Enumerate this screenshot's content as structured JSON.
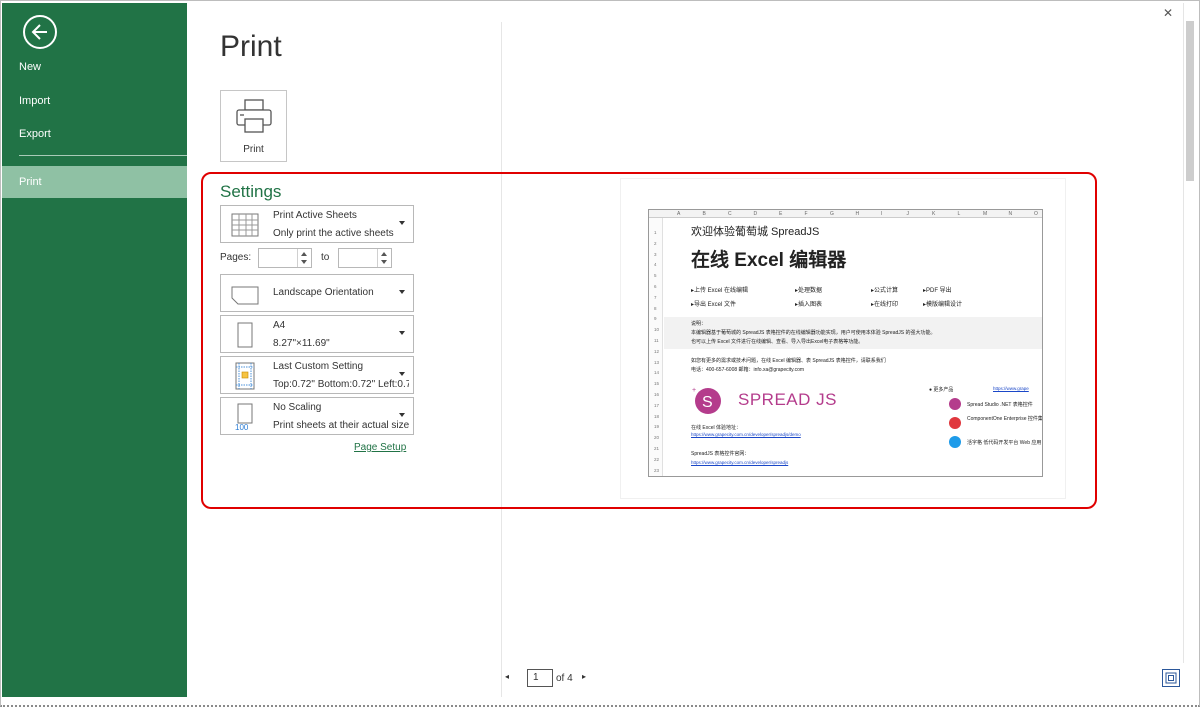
{
  "sidebar": {
    "items": [
      {
        "label": "New"
      },
      {
        "label": "Import"
      },
      {
        "label": "Export"
      },
      {
        "label": "Print"
      }
    ]
  },
  "main": {
    "title": "Print",
    "print_button_label": "Print"
  },
  "settings": {
    "title": "Settings",
    "sheets": {
      "line1": "Print Active Sheets",
      "line2": "Only print the active sheets"
    },
    "pages": {
      "label": "Pages:",
      "to_label": "to",
      "from_value": "",
      "to_value": ""
    },
    "orientation": {
      "line1": "Landscape Orientation"
    },
    "paper": {
      "line1": "A4",
      "line2": "8.27\"×11.69\""
    },
    "margins": {
      "line1": "Last Custom Setting",
      "line2": "Top:0.72\" Bottom:0.72\" Left:0.7\""
    },
    "scaling": {
      "line1": "No Scaling",
      "line2": "Print sheets at their actual size",
      "icon_text": "100"
    },
    "page_setup_link": "Page Setup"
  },
  "preview": {
    "col_headers": [
      "A",
      "B",
      "C",
      "D",
      "E",
      "F",
      "G",
      "H",
      "I",
      "J",
      "K",
      "L",
      "M",
      "N",
      "O"
    ],
    "welcome": "欢迎体验葡萄城 SpreadJS",
    "headline": "在线 Excel 编辑器",
    "bullets": [
      "▸上传 Excel 在线编辑",
      "▸处理数据",
      "▸公式计算",
      "▸PDF 导出",
      "▸导出 Excel 文件",
      "▸插入图表",
      "▸在线打印",
      "▸模版编辑设计"
    ],
    "note_title": "说明：",
    "note_line1": "本编辑器基于葡萄城的 SpreadJS 表格控件的在线编辑器功能实现，用户可使用本体验 SpreadJS 的强大功能。",
    "note_line2": "也可以上传 Excel 文件进行在线编辑、查看、导入导出Excel电子表格等功能。",
    "contact_line": "如您有更多的需求或技术问题，在线 Excel 编辑器、表 SpreadJS 表格控件，请联系我们",
    "phone_line": "电话：400-657-6008      邮箱：info.xa@grapecity.com",
    "logo_text": "SPREAD JS",
    "link1_label": "在线 Excel 体验地址：",
    "link1": "https://www.grapecity.com.cn/developer/spreadjs/demo",
    "link2_label": "SpreadJS 表格控件官网：",
    "link2": "https://www.grapecity.com.cn/developer/spreadjs",
    "side_title": "● 更多产品",
    "side_link": "https://www.grape",
    "products": [
      "Spread Studio .NET 表格控件",
      "ComponentOne Enterprise 控件集",
      "活字格 低代码开发平台 Web 应用"
    ],
    "row_numbers": [
      "1",
      "2",
      "3",
      "4",
      "5",
      "6",
      "7",
      "8",
      "9",
      "10",
      "11",
      "12",
      "13",
      "14",
      "15",
      "16",
      "17",
      "18",
      "19",
      "20",
      "21",
      "22",
      "23"
    ]
  },
  "pager": {
    "current_page": "1",
    "of_label": "of 4"
  },
  "colors": {
    "brand_green": "#217346",
    "sidebar_active": "#8fc1a4",
    "highlight_red": "#e00000",
    "spreadjs_purple": "#b43c8c"
  },
  "icons": {
    "back": "back-arrow-icon",
    "printer": "printer-icon",
    "sheets": "sheet-grid-icon",
    "orientation": "landscape-page-icon",
    "paper": "portrait-page-icon",
    "margins": "margins-icon",
    "scaling": "scaling-icon",
    "zoom": "zoom-to-page-icon"
  }
}
